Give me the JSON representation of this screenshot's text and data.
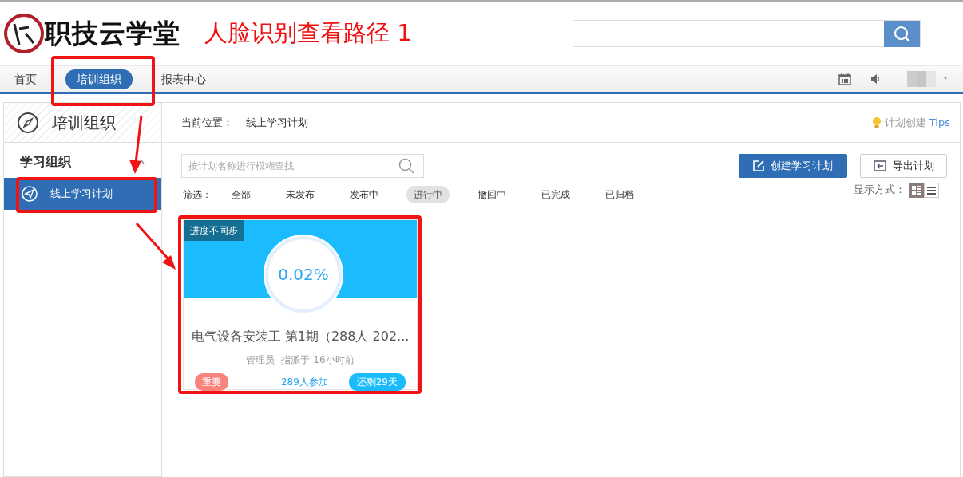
{
  "header": {
    "logo_text": "职技云学堂",
    "annotation_caption": "人脸识别查看路径 1"
  },
  "nav": {
    "items": [
      {
        "label": "首页",
        "selected": false
      },
      {
        "label": "培训组织",
        "selected": true
      },
      {
        "label": "报表中心",
        "selected": false
      }
    ]
  },
  "sidebar": {
    "title": "培训组织",
    "group": "学习组织",
    "items": [
      {
        "label": "线上学习计划",
        "selected": true
      }
    ]
  },
  "breadcrumb": {
    "label": "当前位置：",
    "current": "线上学习计划"
  },
  "tips": {
    "text": "计划创建",
    "link": "Tips"
  },
  "search": {
    "placeholder": "按计划名称进行模糊查找"
  },
  "buttons": [
    {
      "label": "创建学习计划",
      "kind": "primary"
    },
    {
      "label": "导出计划",
      "kind": "outline"
    }
  ],
  "filters": {
    "label": "筛选：",
    "items": [
      {
        "label": "全部",
        "selected": false
      },
      {
        "label": "未发布",
        "selected": false
      },
      {
        "label": "发布中",
        "selected": false
      },
      {
        "label": "进行中",
        "selected": true
      },
      {
        "label": "撤回中",
        "selected": false
      },
      {
        "label": "已完成",
        "selected": false
      },
      {
        "label": "已归档",
        "selected": false
      }
    ]
  },
  "display_mode": {
    "label": "显示方式：",
    "options": [
      {
        "kind": "grid",
        "selected": true
      },
      {
        "kind": "list",
        "selected": false
      }
    ]
  },
  "plans": [
    {
      "tag": "进度不同步",
      "progress": "0.02%",
      "title": "电气设备安装工 第1期（288人 202...",
      "owner": "管理员",
      "assigned": "指派于 16小时前",
      "priority": "重要",
      "participants": "289人参加",
      "remaining": "还剩29天"
    }
  ]
}
